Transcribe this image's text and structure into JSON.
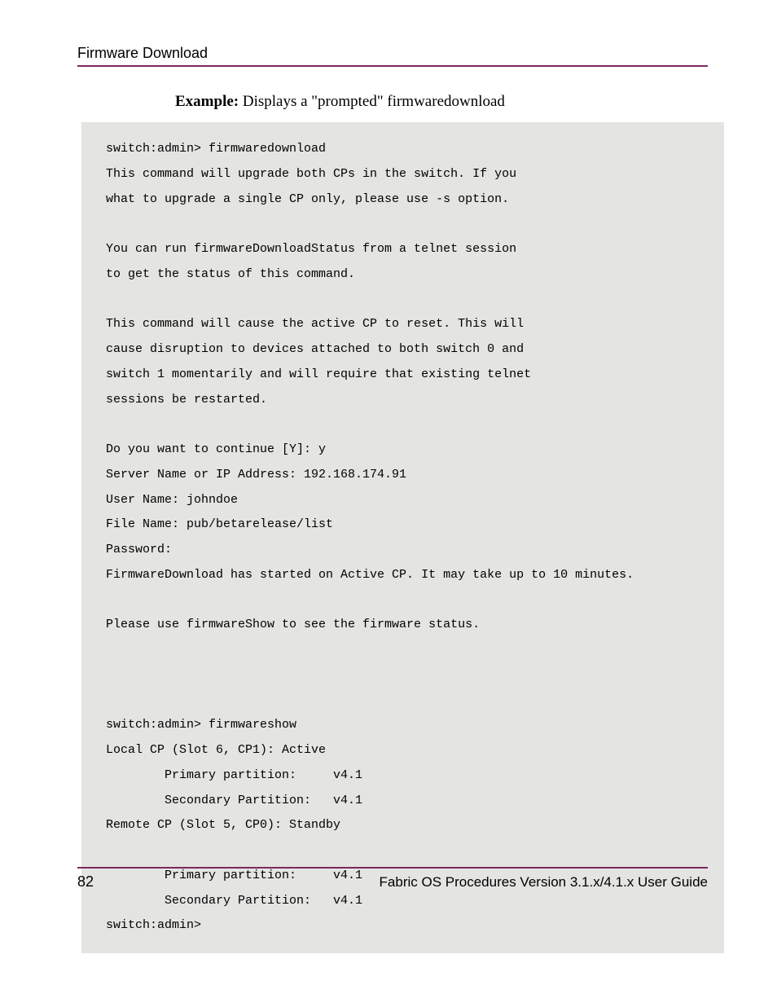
{
  "header": {
    "section_title": "Firmware Download"
  },
  "content": {
    "example_label": "Example:",
    "example_text": " Displays a \"prompted\" firmwaredownload",
    "code": "switch:admin> firmwaredownload\nThis command will upgrade both CPs in the switch. If you\nwhat to upgrade a single CP only, please use -s option.\n\nYou can run firmwareDownloadStatus from a telnet session\nto get the status of this command.\n\nThis command will cause the active CP to reset. This will\ncause disruption to devices attached to both switch 0 and\nswitch 1 momentarily and will require that existing telnet\nsessions be restarted.\n\nDo you want to continue [Y]: y\nServer Name or IP Address: 192.168.174.91\nUser Name: johndoe\nFile Name: pub/betarelease/list\nPassword:\nFirmwareDownload has started on Active CP. It may take up to 10 minutes.\n\nPlease use firmwareShow to see the firmware status.\n\n\n\nswitch:admin> firmwareshow\nLocal CP (Slot 6, CP1): Active\n        Primary partition:     v4.1\n        Secondary Partition:   v4.1\nRemote CP (Slot 5, CP0): Standby\n\n        Primary partition:     v4.1\n        Secondary Partition:   v4.1\nswitch:admin>"
  },
  "footer": {
    "page_number": "82",
    "doc_title": "Fabric OS Procedures Version 3.1.x/4.1.x User Guide"
  }
}
